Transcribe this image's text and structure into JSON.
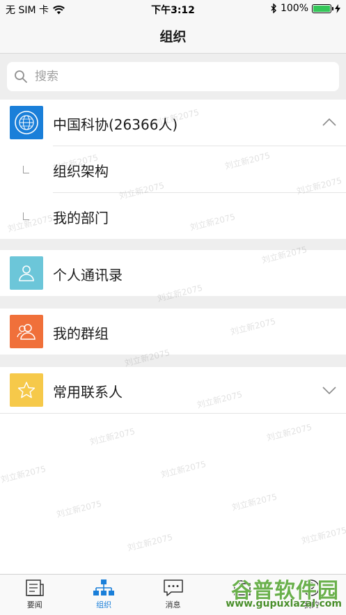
{
  "status_bar": {
    "carrier": "无 SIM 卡",
    "time": "下午3:12",
    "battery_text": "100%",
    "battery_level": 1.0
  },
  "nav": {
    "title": "组织"
  },
  "search": {
    "placeholder": "搜索"
  },
  "org": {
    "label": "中国科协(26366人)",
    "expanded": true,
    "children": [
      {
        "label": "组织架构"
      },
      {
        "label": "我的部门"
      }
    ]
  },
  "contacts": {
    "personal": {
      "label": "个人通讯录",
      "color": "#6cc6d9"
    },
    "groups": {
      "label": "我的群组",
      "color": "#f0703a"
    },
    "frequent": {
      "label": "常用联系人",
      "color": "#f6c94a"
    }
  },
  "watermark_text": "刘立新2075",
  "tabs": [
    {
      "label": "要闻",
      "icon": "news-icon",
      "active": false
    },
    {
      "label": "组织",
      "icon": "org-chart-icon",
      "active": true
    },
    {
      "label": "消息",
      "icon": "chat-icon",
      "active": false
    },
    {
      "label": "",
      "icon": "work-icon",
      "active": false
    },
    {
      "label": "我的",
      "icon": "profile-icon",
      "active": false
    }
  ],
  "site_watermark": {
    "title": "谷普软件园",
    "url": "www.gupuxlazal.com"
  },
  "colors": {
    "accent": "#1a7fd9",
    "org_logo_bg": "#1a7fd9"
  }
}
